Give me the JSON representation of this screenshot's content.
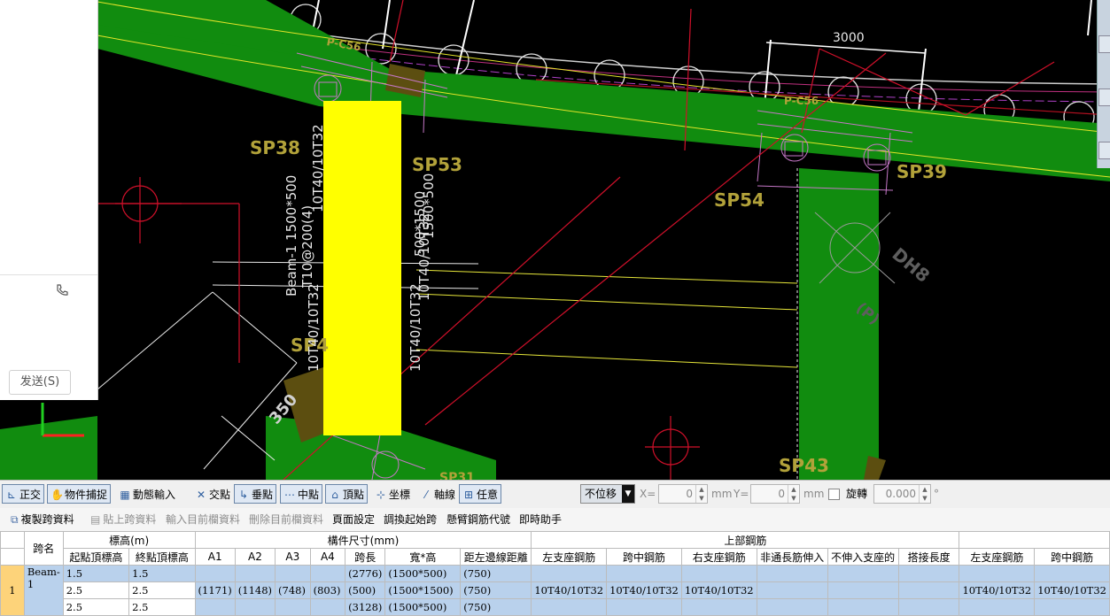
{
  "chat": {
    "send_label": "发送(S)",
    "phone_icon": "phone-icon"
  },
  "canvas": {
    "labels": {
      "sp38": "SP38",
      "sp53": "SP53",
      "sp54": "SP54",
      "sp39": "SP39",
      "sp43": "SP43",
      "dh8": "DH8",
      "p_paren": "(P)",
      "pc56_right": "P-C56",
      "pc56_left": "P-C56",
      "dim3000": "3000",
      "dim350": "350",
      "sp4": "SP4",
      "sp31": "SP31"
    },
    "beam_text": {
      "left_line1": "Beam-1 1500*500",
      "left_line2": "10T40/10T32",
      "left_line3": "T10@200(4)",
      "left_line4": "10T40/10T32",
      "right_line1": "10T40/10T32",
      "right_line2": "10T40/10T32",
      "right_line3": "500*1500",
      "right_line4": "1500*500"
    },
    "colors": {
      "beam_green": "#118c0f",
      "highlight_yellow": "#ffff00",
      "label_gold": "#b2a23a",
      "axis_red": "#d0102a"
    }
  },
  "snap_toolbar": {
    "buttons": [
      {
        "label": "正交",
        "icon": "orthogonal-icon",
        "on": true
      },
      {
        "label": "物件捕捉",
        "icon": "object-snap-icon",
        "on": true
      },
      {
        "label": "動態輸入",
        "icon": "dynamic-input-icon",
        "on": false
      },
      {
        "label": "交點",
        "icon": "intersection-icon",
        "on": false
      },
      {
        "label": "垂點",
        "icon": "perpendicular-icon",
        "on": true
      },
      {
        "label": "中點",
        "icon": "midpoint-icon",
        "on": true
      },
      {
        "label": "頂點",
        "icon": "vertex-icon",
        "on": true
      },
      {
        "label": "坐標",
        "icon": "coordinate-icon",
        "on": false
      },
      {
        "label": "軸線",
        "icon": "axis-icon",
        "on": false
      },
      {
        "label": "任意",
        "icon": "any-point-icon",
        "on": true
      }
    ],
    "move_mode": "不位移",
    "x_label": "X=",
    "x_value": "0",
    "x_unit": "mm",
    "y_label": "Y=",
    "y_value": "0",
    "y_unit": "mm",
    "rotate_label": "旋轉",
    "rotate_value": "0.000",
    "rotate_unit": "°"
  },
  "table_toolbar": {
    "buttons": [
      {
        "label": "複製跨資料",
        "disabled": false
      },
      {
        "label": "貼上跨資料",
        "disabled": true
      },
      {
        "label": "輸入目前欄資料",
        "disabled": true
      },
      {
        "label": "刪除目前欄資料",
        "disabled": true
      },
      {
        "label": "頁面設定",
        "disabled": false
      },
      {
        "label": "調換起始跨",
        "disabled": false
      },
      {
        "label": "懸臂鋼筋代號",
        "disabled": false
      },
      {
        "label": "即時助手",
        "disabled": false
      }
    ]
  },
  "grid": {
    "group_headers": {
      "span_name": "跨名",
      "elevation": "標高(m)",
      "member_size": "構件尺寸(mm)",
      "top_rebar": "上部鋼筋"
    },
    "sub_headers": [
      "起點頂標高",
      "終點頂標高",
      "A1",
      "A2",
      "A3",
      "A4",
      "跨長",
      "寬*高",
      "距左邊線距離",
      "左支座鋼筋",
      "跨中鋼筋",
      "右支座鋼筋",
      "非通長筋伸入",
      "不伸入支座的",
      "搭接長度",
      "左支座鋼筋",
      "跨中鋼筋"
    ],
    "row_number": "1",
    "span_name": "Beam-1",
    "rows": [
      [
        "1.5",
        "1.5",
        "",
        "",
        "",
        "",
        "(2776)",
        "(1500*500)",
        "(750)",
        "",
        "",
        "",
        "",
        "",
        "",
        "",
        ""
      ],
      [
        "2.5",
        "2.5",
        "(1171)",
        "(1148)",
        "(748)",
        "(803)",
        "(500)",
        "(1500*1500)",
        "(750)",
        "10T40/10T32",
        "10T40/10T32",
        "10T40/10T32",
        "",
        "",
        "",
        "10T40/10T32",
        "10T40/10T32"
      ],
      [
        "2.5",
        "2.5",
        "",
        "",
        "",
        "",
        "(3128)",
        "(1500*500)",
        "(750)",
        "",
        "",
        "",
        "",
        "",
        "",
        "",
        ""
      ]
    ]
  }
}
